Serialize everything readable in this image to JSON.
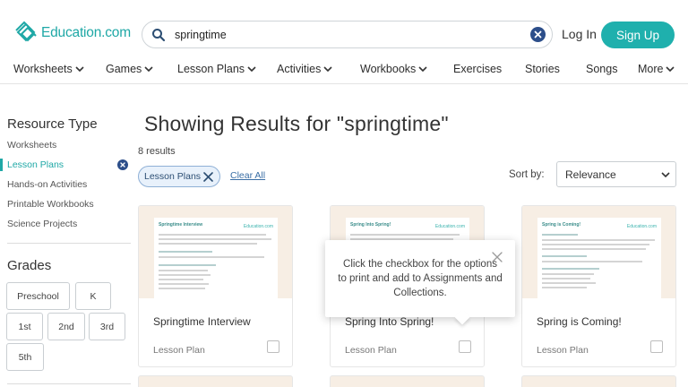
{
  "header": {
    "logo_text": "Education.com",
    "search": {
      "value": "springtime"
    },
    "login_label": "Log In",
    "signup_label": "Sign Up"
  },
  "nav": {
    "items": [
      {
        "label": "Worksheets",
        "has_dropdown": true
      },
      {
        "label": "Games",
        "has_dropdown": true
      },
      {
        "label": "Lesson Plans",
        "has_dropdown": true
      },
      {
        "label": "Activities",
        "has_dropdown": true
      },
      {
        "label": "Workbooks",
        "has_dropdown": true
      },
      {
        "label": "Exercises",
        "has_dropdown": false
      },
      {
        "label": "Stories",
        "has_dropdown": false
      },
      {
        "label": "Songs",
        "has_dropdown": false
      },
      {
        "label": "More",
        "has_dropdown": true
      }
    ]
  },
  "sidebar": {
    "resource_type_title": "Resource Type",
    "resource_types": [
      {
        "label": "Worksheets",
        "active": false
      },
      {
        "label": "Lesson Plans",
        "active": true
      },
      {
        "label": "Hands-on Activities",
        "active": false
      },
      {
        "label": "Printable Workbooks",
        "active": false
      },
      {
        "label": "Science Projects",
        "active": false
      }
    ],
    "grades_title": "Grades",
    "grades": [
      "Preschool",
      "K",
      "1st",
      "2nd",
      "3rd",
      "5th"
    ]
  },
  "results": {
    "heading": "Showing Results for \"springtime\"",
    "count": "8 results",
    "filter_chip": "Lesson Plans",
    "clear_all": "Clear All",
    "sort_label": "Sort by:",
    "sort_value": "Relevance"
  },
  "cards": [
    {
      "title": "Springtime Interview",
      "type": "Lesson Plan",
      "thumb_title": "Springtime Interview",
      "thumb_logo": "Education.com"
    },
    {
      "title": "Spring Into Spring!",
      "type": "Lesson Plan",
      "thumb_title": "Spring Into Spring!",
      "thumb_logo": "Education.com"
    },
    {
      "title": "Spring is Coming!",
      "type": "Lesson Plan",
      "thumb_title": "Spring is Coming!",
      "thumb_logo": "Education.com"
    }
  ],
  "tooltip": {
    "text": "Click the checkbox for the options to print and add to Assignments and Collections."
  },
  "colors": {
    "brand": "#1fa8a6",
    "signup_bg": "#1fb0ad",
    "chip_border": "#8fb0d6",
    "card_thumb_bg": "#f7eee4"
  }
}
